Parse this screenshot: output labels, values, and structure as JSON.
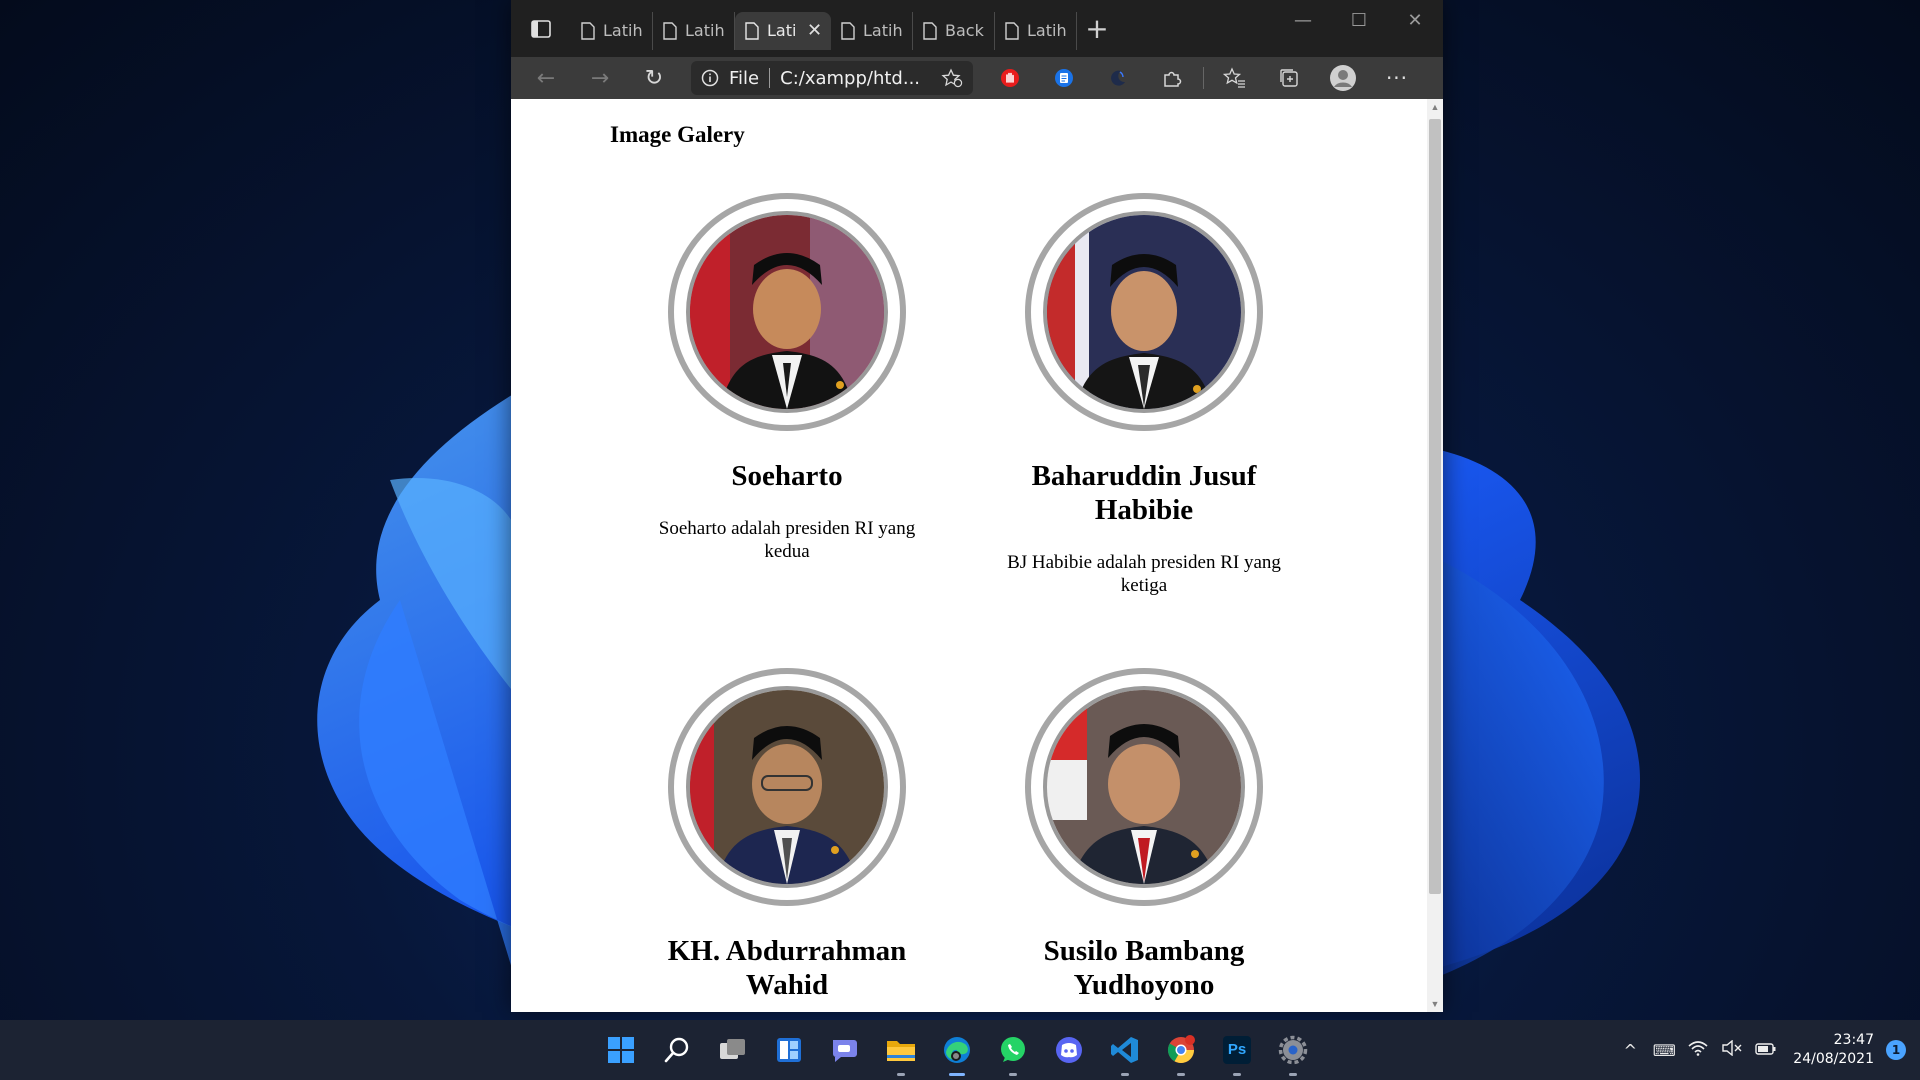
{
  "browser": {
    "tabs": [
      {
        "label": "LatihanC",
        "active": false
      },
      {
        "label": "LatihanC",
        "active": false
      },
      {
        "label": "Lati",
        "active": true
      },
      {
        "label": "LatihanC",
        "active": false
      },
      {
        "label": "Backgro",
        "active": false
      },
      {
        "label": "LatihanC",
        "active": false
      }
    ],
    "address": {
      "scheme_label": "File",
      "url": "C:/xampp/htd..."
    }
  },
  "page": {
    "title": "Image Galery",
    "cards": [
      {
        "name": "Soeharto",
        "caption": "Soeharto adalah presiden RI yang kedua"
      },
      {
        "name": "Baharuddin Jusuf Habibie",
        "caption": "BJ Habibie adalah presiden RI yang ketiga"
      },
      {
        "name": "KH. Abdurrahman Wahid",
        "caption": ""
      },
      {
        "name": "Susilo Bambang Yudhoyono",
        "caption": ""
      }
    ]
  },
  "taskbar": {
    "apps": [
      "start-icon",
      "search-icon",
      "task-view-icon",
      "widgets-icon",
      "teams-chat-icon",
      "file-explorer-icon",
      "edge-icon",
      "whatsapp-icon",
      "discord-icon",
      "vscode-icon",
      "chrome-icon",
      "photoshop-icon",
      "settings-icon"
    ],
    "photoshop_label": "Ps",
    "time": "23:47",
    "date": "24/08/2021",
    "notification_count": "1"
  },
  "colors": {
    "accent": "#0a5cff",
    "window_bg": "#ffffff",
    "tab_strip": "#202020",
    "toolbar": "#3b3b3b"
  }
}
